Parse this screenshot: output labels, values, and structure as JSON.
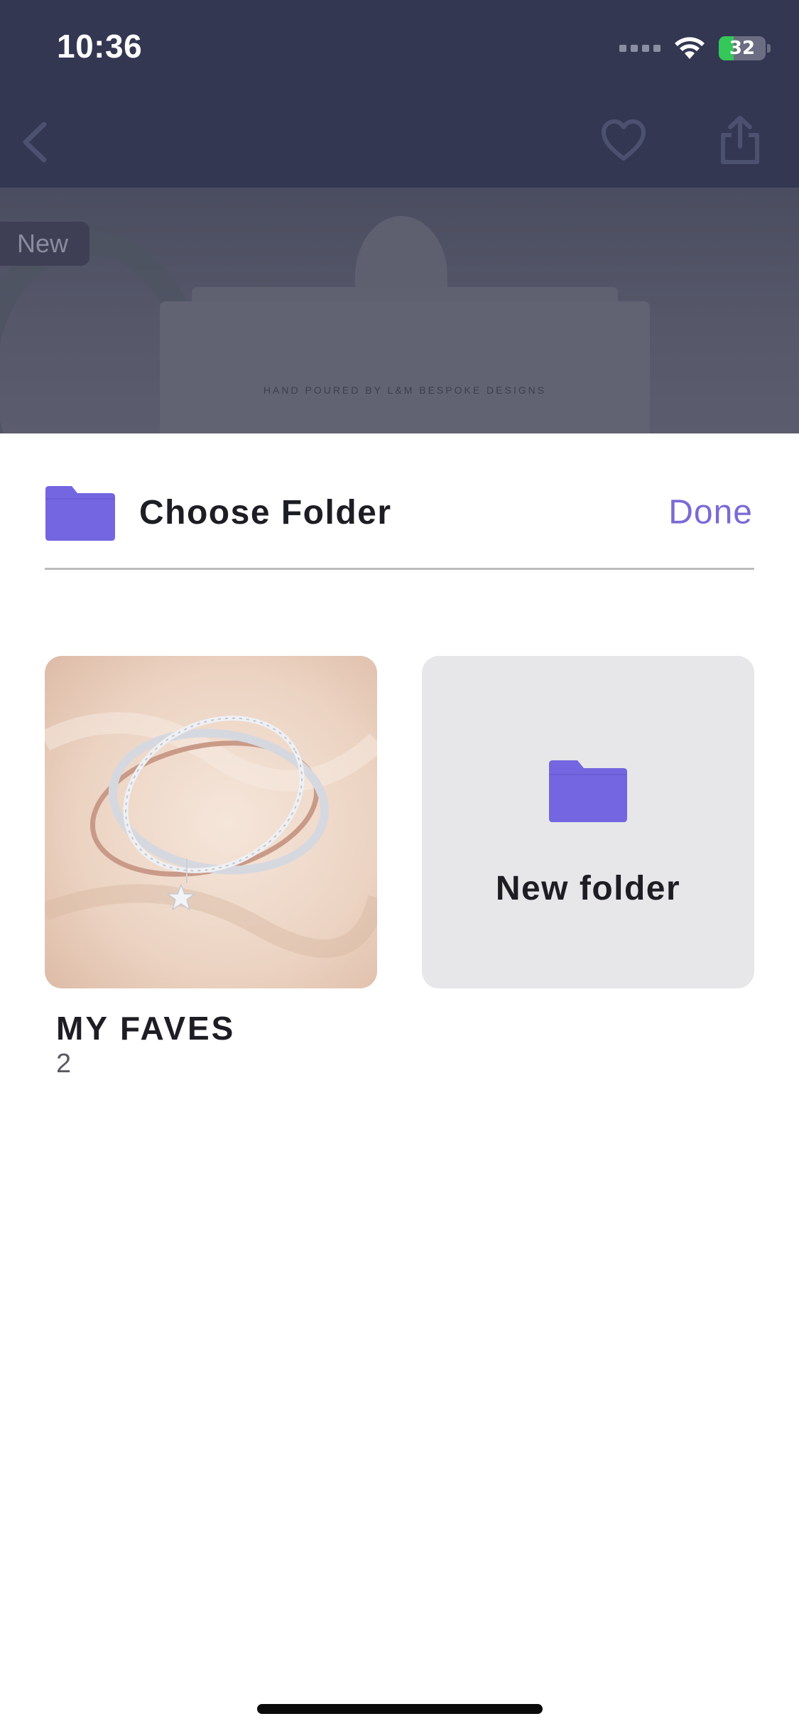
{
  "status_bar": {
    "time": "10:36",
    "battery_level": "32"
  },
  "product_page": {
    "badge": "New",
    "product_label_text": "HAND POURED BY L&M BESPOKE DESIGNS"
  },
  "sheet": {
    "title": "Choose Folder",
    "done_label": "Done",
    "folders": [
      {
        "name": "MY FAVES",
        "count": "2"
      }
    ],
    "new_folder_label": "New folder"
  },
  "colors": {
    "accent": "#7a6ad6",
    "folder_icon": "#7366e0",
    "header_overlay": "#333752",
    "card_bg": "#e7e7e9"
  },
  "icons": {
    "back": "chevron-left-icon",
    "favorite": "heart-icon",
    "share": "share-icon",
    "folder": "folder-icon",
    "wifi": "wifi-icon",
    "battery": "battery-icon"
  }
}
